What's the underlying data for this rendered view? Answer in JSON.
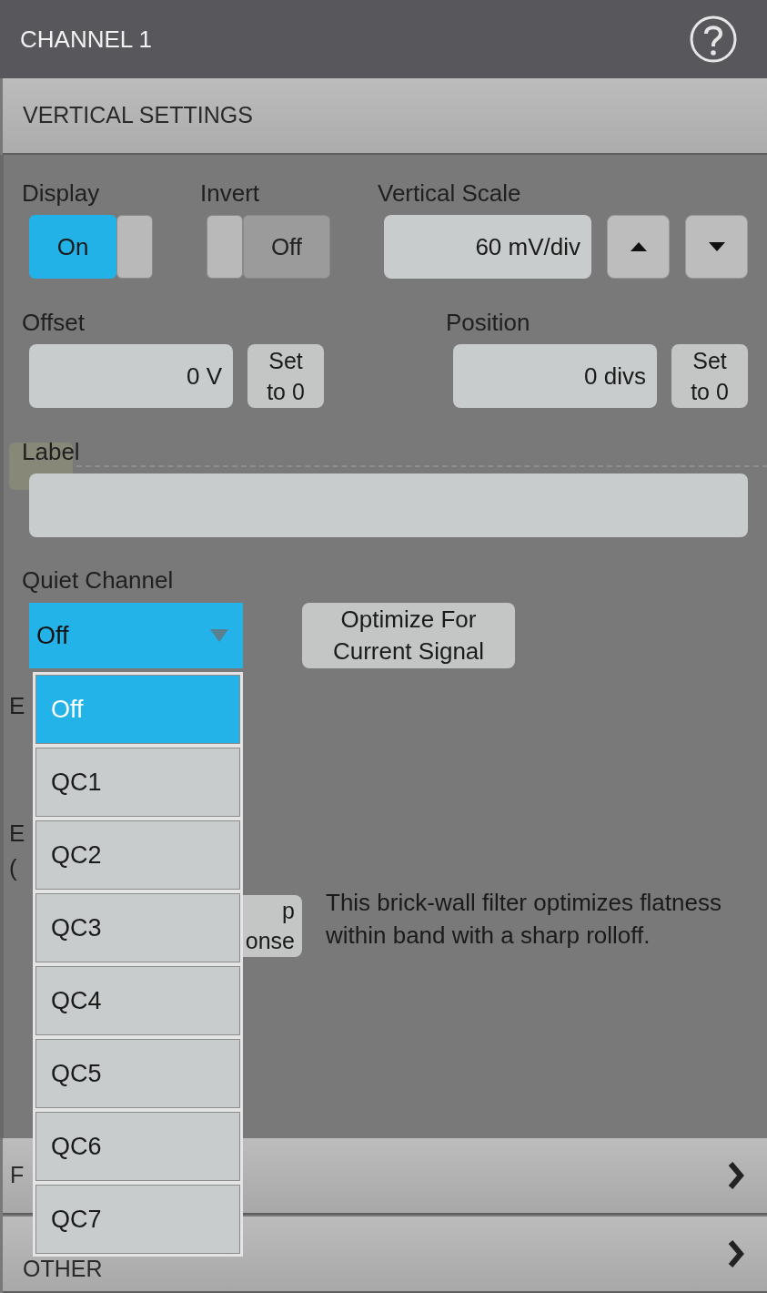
{
  "header": {
    "title": "CHANNEL 1"
  },
  "section": {
    "title": "VERTICAL SETTINGS"
  },
  "display": {
    "label": "Display",
    "value": "On",
    "on": true
  },
  "invert": {
    "label": "Invert",
    "value": "Off",
    "on": false
  },
  "vertical_scale": {
    "label": "Vertical Scale",
    "value": "60 mV/div"
  },
  "offset": {
    "label": "Offset",
    "value": "0 V",
    "button_lines": [
      "Set",
      "to 0"
    ]
  },
  "position": {
    "label": "Position",
    "value": "0 divs",
    "button_lines": [
      "Set",
      "to 0"
    ]
  },
  "label_field": {
    "label": "Label"
  },
  "quiet_channel": {
    "label": "Quiet Channel",
    "value": "Off",
    "expanded": true,
    "optimize_lines": [
      "Optimize For",
      "Current Signal"
    ],
    "options": [
      {
        "label": "Off",
        "selected": true
      },
      {
        "label": "QC1",
        "selected": false
      },
      {
        "label": "QC2",
        "selected": false
      },
      {
        "label": "QC3",
        "selected": false
      },
      {
        "label": "QC4",
        "selected": false
      },
      {
        "label": "QC5",
        "selected": false
      },
      {
        "label": "QC6",
        "selected": false
      },
      {
        "label": "QC7",
        "selected": false
      }
    ]
  },
  "covered_labels": [
    "E",
    "E",
    "("
  ],
  "covered_button_lines": [
    "p",
    "onse"
  ],
  "description": "This brick-wall filter optimizes flatness within band with a sharp rolloff.",
  "collapsed_sections": [
    {
      "title": "F",
      "expanded": false
    },
    {
      "title": "OTHER",
      "expanded": false
    }
  ]
}
